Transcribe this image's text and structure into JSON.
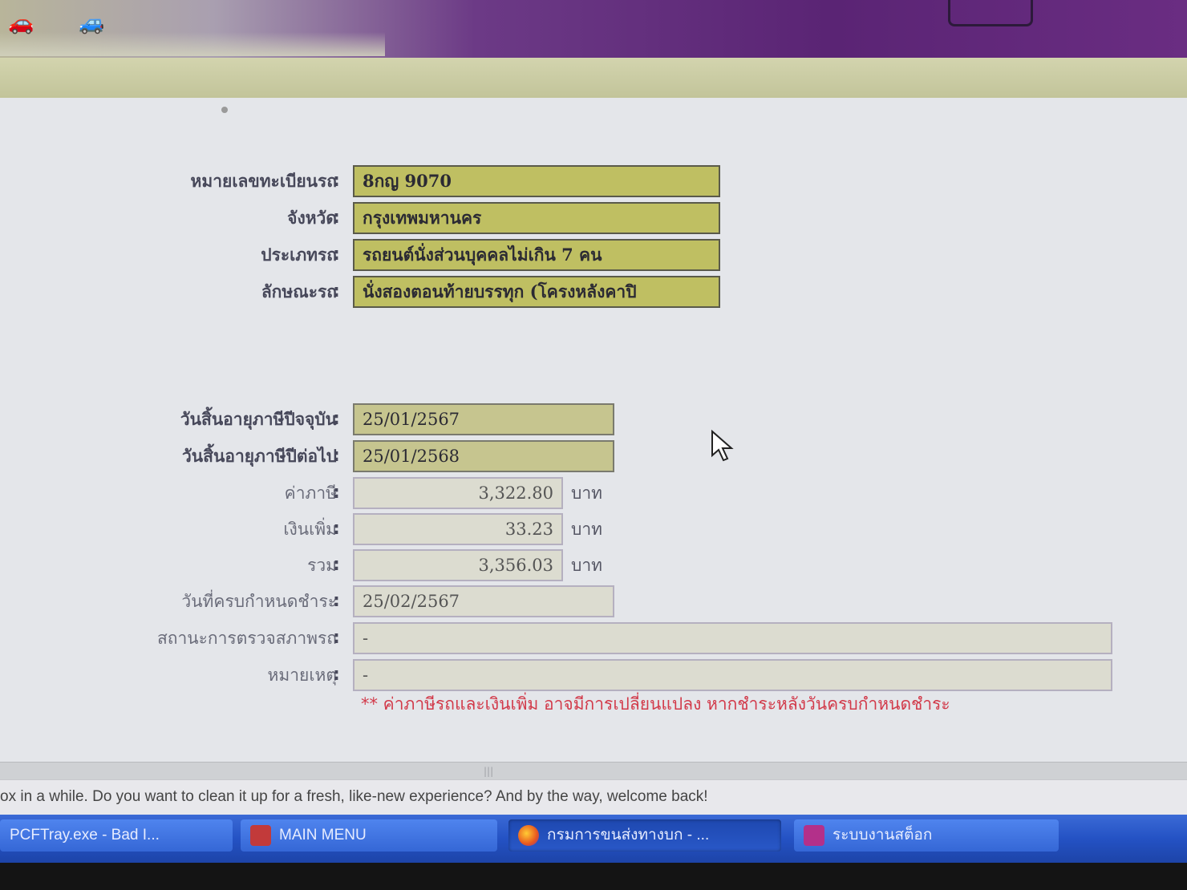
{
  "banner": {
    "text": "...",
    "logo_icon": "dlt-logo-icon"
  },
  "form": {
    "vehicle": [
      {
        "label": "หมายเลขทะเบียนรถ",
        "value": "8กญ 9070"
      },
      {
        "label": "จังหวัด",
        "value": "กรุงเทพมหานคร"
      },
      {
        "label": "ประเภทรถ",
        "value": "รถยนต์นั่งส่วนบุคคลไม่เกิน 7 คน"
      },
      {
        "label": "ลักษณะรถ",
        "value": "นั่งสองตอนท้ายบรรทุก (โครงหลังคาปิ"
      }
    ],
    "tax": {
      "current_expiry": {
        "label": "วันสิ้นอายุภาษีปีจจุบัน",
        "value": "25/01/2567"
      },
      "next_expiry": {
        "label": "วันสิ้นอายุภาษีปีต่อไป",
        "value": "25/01/2568"
      },
      "tax_amount": {
        "label": "ค่าภาษี",
        "value": "3,322.80",
        "unit": "บาท"
      },
      "surcharge": {
        "label": "เงินเพิ่ม",
        "value": "33.23",
        "unit": "บาท"
      },
      "total": {
        "label": "รวม",
        "value": "3,356.03",
        "unit": "บาท"
      },
      "due_date": {
        "label": "วันที่ครบกำหนดชำระ",
        "value": "25/02/2567"
      },
      "inspection_status": {
        "label": "สถานะการตรวจสภาพรถ",
        "value": "-"
      },
      "remark": {
        "label": "หมายเหตุ",
        "value": "-"
      }
    },
    "colon": ":",
    "note": "** ค่าภาษีรถและเงินเพิ่ม อาจมีการเปลี่ยนแปลง หากชำระหลังวันครบกำหนดชำระ"
  },
  "notification": {
    "text": "ox in a while. Do you want to clean it up for a fresh, like-new experience? And by the way, welcome back!"
  },
  "taskbar": {
    "items": [
      {
        "label": "PCFTray.exe - Bad I...",
        "icon": "app-icon"
      },
      {
        "label": "MAIN MENU",
        "icon": "menu-app-icon"
      },
      {
        "label": "กรมการขนส่งทางบก - ...",
        "icon": "firefox-icon"
      },
      {
        "label": "ระบบงานสต็อก",
        "icon": "stock-app-icon"
      }
    ]
  },
  "colors": {
    "olive_field": "#bfbf62",
    "banner_purple": "#5a2474",
    "warning_red": "#d23a4a",
    "taskbar_blue": "#2452c4"
  }
}
